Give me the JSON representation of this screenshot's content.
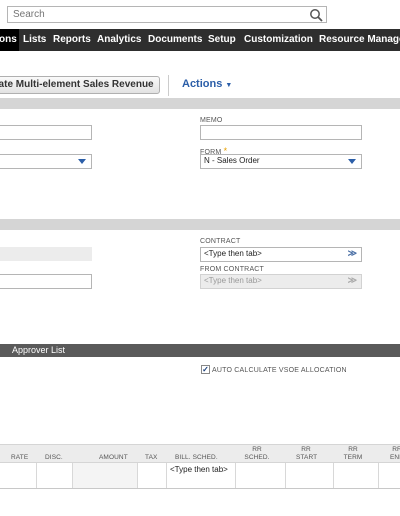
{
  "search": {
    "placeholder": "Search"
  },
  "nav": {
    "items": [
      "ons",
      "Lists",
      "Reports",
      "Analytics",
      "Documents",
      "Setup",
      "Customization",
      "Resource Manager"
    ]
  },
  "toolbar": {
    "calc_label": "cate Multi-element Sales Revenue",
    "actions_label": "Actions"
  },
  "primary": {
    "memo_label": "MEMO",
    "form_label": "FORM",
    "form_value": "N - Sales Order"
  },
  "contract": {
    "contract_label": "CONTRACT",
    "contract_value": "<Type then tab>",
    "from_contract_label": "FROM CONTRACT",
    "from_contract_value": "<Type then tab>"
  },
  "approver": {
    "title": "Approver List"
  },
  "vsoe": {
    "label": "AUTO CALCULATE VSOE ALLOCATION",
    "checked": true
  },
  "table": {
    "headers": [
      "RATE",
      "DISC.",
      "AMOUNT",
      "TAX",
      "BILL. SCHED.",
      "RR SCHED.",
      "RR START",
      "RR TERM",
      "RR END"
    ],
    "bill_sched_value": "<Type then tab>"
  }
}
